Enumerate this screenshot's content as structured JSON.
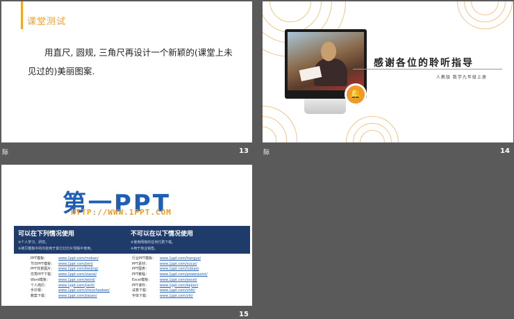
{
  "slide13": {
    "title": "课堂测试",
    "body": "用直尺, 圆规, 三角尺再设计一个新颖的(课堂上未见过的)美丽图案.",
    "number": "13",
    "corner": "际"
  },
  "slide14": {
    "title": "感谢各位的聆听指导",
    "subtitle": "人教版  数学九年级上册",
    "icon": "bell-icon",
    "number": "14",
    "corner": "际"
  },
  "slide15": {
    "logo_text": "第一PPT",
    "logo_url": "HTTP://WWW.1PPT.COM",
    "can_use_title": "可以在下列情况使用",
    "can_use_items": [
      "※个人学习、研究。",
      "※拷贝模板中的内容用于其它幻灯片母版中使用。"
    ],
    "cannot_use_title": "不可以在以下情况使用",
    "cannot_use_items": [
      "※使用网络的任何付费下载。",
      "※用于商业销售。"
    ],
    "left_links": [
      {
        "label": "PPT模板：",
        "url": "www.1ppt.com/moban/"
      },
      {
        "label": "节日PPT模板：",
        "url": "www.1ppt.com/jieri/"
      },
      {
        "label": "PPT背景图片：",
        "url": "www.1ppt.com/beijing/"
      },
      {
        "label": "优秀PPT下载：",
        "url": "www.1ppt.com/xiazai/"
      },
      {
        "label": "Word模板：",
        "url": "www.1ppt.com/word/"
      },
      {
        "label": "个人简历：",
        "url": "www.1ppt.com/jianli/"
      },
      {
        "label": "手抄报：",
        "url": "www.1ppt.com/shouchaobao/"
      },
      {
        "label": "教案下载：",
        "url": "www.1ppt.com/jiaoan/"
      }
    ],
    "right_links": [
      {
        "label": "行业PPT模板：",
        "url": "www.1ppt.com/hangye/"
      },
      {
        "label": "PPT素材：",
        "url": "www.1ppt.com/sucai/"
      },
      {
        "label": "PPT图表：",
        "url": "www.1ppt.com/tubiao/"
      },
      {
        "label": "PPT教程：",
        "url": "www.1ppt.com/powerpoint/"
      },
      {
        "label": "Excel模板：",
        "url": "www.1ppt.com/excel/"
      },
      {
        "label": "PPT课件：",
        "url": "www.1ppt.com/kejian/"
      },
      {
        "label": "试卷下载：",
        "url": "www.1ppt.com/shiti/"
      },
      {
        "label": "字体下载：",
        "url": "www.1ppt.com/ziti/"
      }
    ],
    "number": "15"
  }
}
